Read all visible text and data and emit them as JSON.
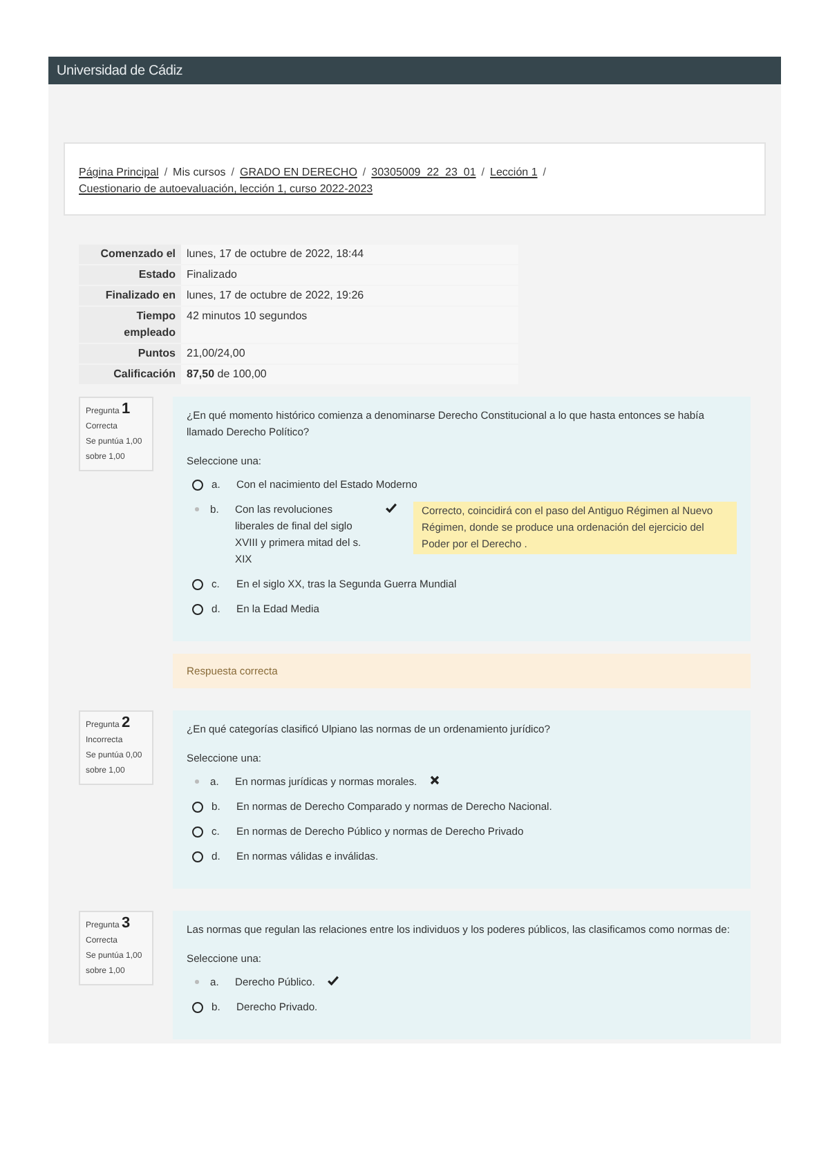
{
  "header": {
    "brand": "Universidad de Cádiz"
  },
  "breadcrumb": {
    "separator": "/",
    "items": [
      {
        "label": "Página Principal",
        "link": true
      },
      {
        "label": "Mis cursos",
        "link": false
      },
      {
        "label": "GRADO EN DERECHO",
        "link": true
      },
      {
        "label": "30305009_22_23_01",
        "link": true
      },
      {
        "label": "Lección 1",
        "link": true
      },
      {
        "label": "Cuestionario de autoevaluación, lección 1, curso 2022-2023",
        "link": true
      }
    ]
  },
  "summary": [
    {
      "label": "Comenzado el",
      "value": "lunes, 17 de octubre de 2022, 18:44"
    },
    {
      "label": "Estado",
      "value": "Finalizado"
    },
    {
      "label": "Finalizado en",
      "value": "lunes, 17 de octubre de 2022, 19:26"
    },
    {
      "label": "Tiempo empleado",
      "value": "42 minutos 10 segundos"
    },
    {
      "label": "Puntos",
      "value": "21,00/24,00"
    },
    {
      "label": "Calificación",
      "value": "**87,50** de 100,00"
    }
  ],
  "questions": [
    {
      "label": "Pregunta",
      "number": "1",
      "status": "Correcta",
      "score": "Se puntúa 1,00 sobre 1,00",
      "text": "¿En qué momento histórico comienza a denominarse Derecho Constitucional a lo que hasta entonces se había llamado Derecho Político?",
      "prompt": "Seleccione una:",
      "options": [
        {
          "letter": "a.",
          "text": "Con el nacimiento del Estado Moderno",
          "selected": false
        },
        {
          "letter": "b.",
          "text": "Con las revoluciones liberales de final del siglo XVIII y primera mitad del s. XIX",
          "selected": true,
          "correct": true,
          "feedback": "Correcto, coincidirá con el paso del Antiguo Régimen al Nuevo Régimen, donde se produce una ordenación del ejercicio del Poder por el Derecho ."
        },
        {
          "letter": "c.",
          "text": "En el siglo XX, tras la Segunda Guerra Mundial",
          "selected": false
        },
        {
          "letter": "d.",
          "text": "En la Edad Media",
          "selected": false
        }
      ],
      "outcome": "Respuesta correcta"
    },
    {
      "label": "Pregunta",
      "number": "2",
      "status": "Incorrecta",
      "score": "Se puntúa 0,00 sobre 1,00",
      "text": "¿En qué categorías clasificó Ulpiano las normas de un ordenamiento jurídico?",
      "prompt": "Seleccione una:",
      "options": [
        {
          "letter": "a.",
          "text": "En normas jurídicas y normas morales.",
          "selected": true,
          "correct": false
        },
        {
          "letter": "b.",
          "text": "En normas de Derecho Comparado y normas de Derecho Nacional.",
          "selected": false
        },
        {
          "letter": "c.",
          "text": "En normas de Derecho Público y normas de Derecho Privado",
          "selected": false
        },
        {
          "letter": "d.",
          "text": "En normas válidas e inválidas.",
          "selected": false
        }
      ]
    },
    {
      "label": "Pregunta",
      "number": "3",
      "status": "Correcta",
      "score": "Se puntúa 1,00 sobre 1,00",
      "text": "Las normas que regulan las relaciones entre los individuos y los poderes públicos, las clasificamos como normas de:",
      "prompt": "Seleccione una:",
      "options": [
        {
          "letter": "a.",
          "text": "Derecho Público.",
          "selected": true,
          "correct": true
        },
        {
          "letter": "b.",
          "text": "Derecho Privado.",
          "selected": false
        }
      ]
    }
  ]
}
